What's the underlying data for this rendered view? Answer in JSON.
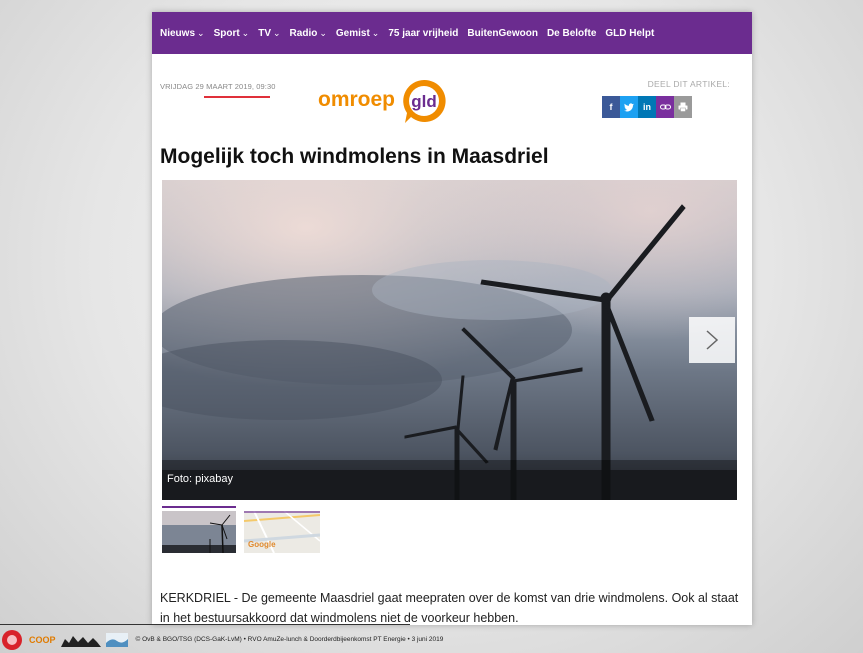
{
  "nav": {
    "items": [
      {
        "label": "Nieuws",
        "dropdown": true
      },
      {
        "label": "Sport",
        "dropdown": true
      },
      {
        "label": "TV",
        "dropdown": true
      },
      {
        "label": "Radio",
        "dropdown": true
      },
      {
        "label": "Gemist",
        "dropdown": true
      },
      {
        "label": "75 jaar vrijheid",
        "dropdown": false
      },
      {
        "label": "BuitenGewoon",
        "dropdown": false
      },
      {
        "label": "De Belofte",
        "dropdown": false
      },
      {
        "label": "GLD Helpt",
        "dropdown": false
      }
    ],
    "color": "#6b2c8f"
  },
  "article": {
    "date": "VRIJDAG 29 MAART 2019, 09:30",
    "logo_word": "omroep",
    "logo_mark": "gld",
    "share_label": "DEEL DIT ARTIKEL:",
    "share_buttons": [
      {
        "icon": "facebook-icon",
        "glyph": "f",
        "color": "#3b5998"
      },
      {
        "icon": "twitter-icon",
        "glyph": "♥",
        "color": "#1da1f2"
      },
      {
        "icon": "linkedin-icon",
        "glyph": "in",
        "color": "#0077b5"
      },
      {
        "icon": "link-icon",
        "glyph": "∞",
        "color": "#7a2f9e"
      },
      {
        "icon": "print-icon",
        "glyph": "⎙",
        "color": "#9a9a9a"
      }
    ],
    "headline": "Mogelijk toch windmolens in Maasdriel",
    "photo_caption": "Foto: pixabay",
    "map_thumb_label": "Google",
    "lead": "KERKDRIEL - De gemeente Maasdriel gaat meepraten over de komst van drie windmolens. Ook al staat in het bestuursakkoord dat windmolens niet de voorkeur hebben."
  },
  "footer": {
    "logo_coop": "COOP",
    "text": "© OvB & BGO/TSG (DCS-GaK-LvM) • RVO AmuZe-lunch & Doorderdbijeenkomst PT Energie • 3 juni 2019"
  }
}
